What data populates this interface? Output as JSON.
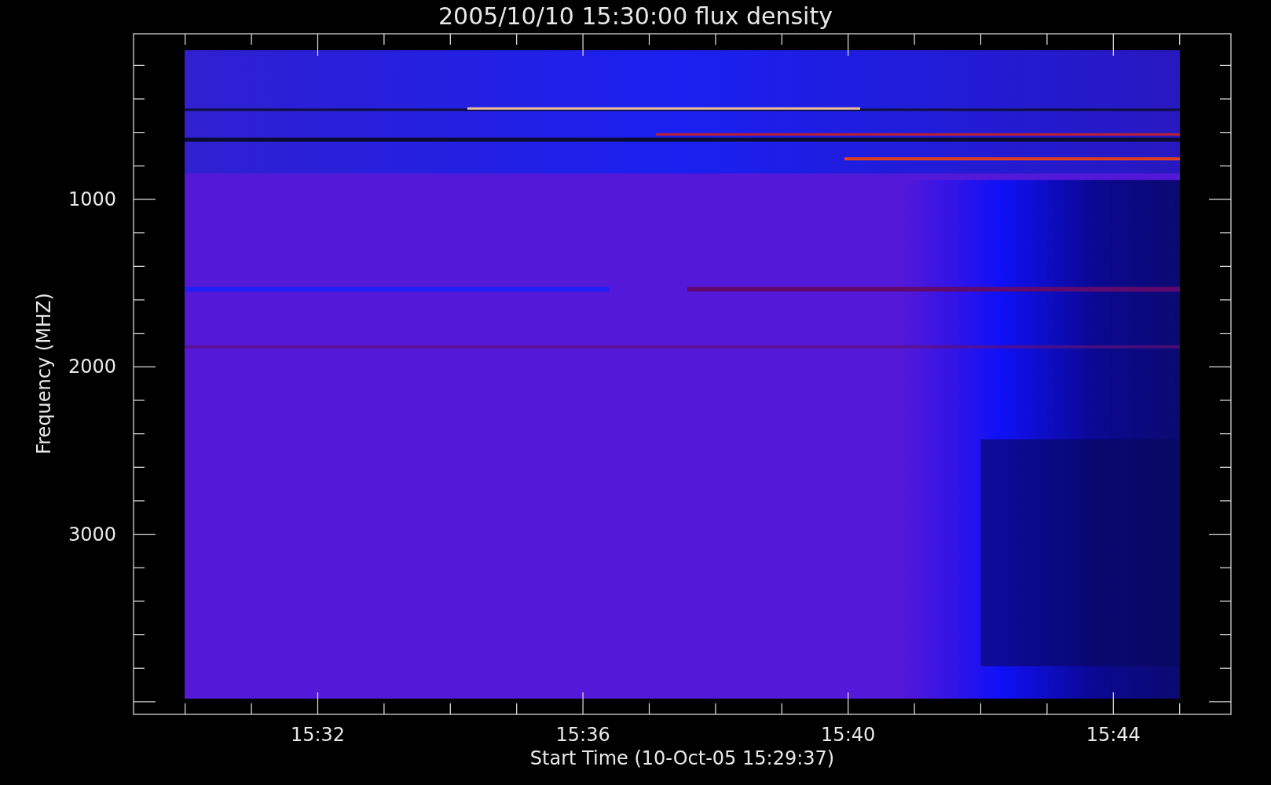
{
  "title": "2005/10/10 15:30:00 flux density",
  "y_axis": {
    "label": "Frequency (MHZ)",
    "ticks": [
      "1000",
      "2000",
      "3000"
    ]
  },
  "x_axis": {
    "label": "Start Time (10-Oct-05 15:29:37)",
    "ticks": [
      "15:32",
      "15:36",
      "15:40",
      "15:44"
    ]
  }
}
